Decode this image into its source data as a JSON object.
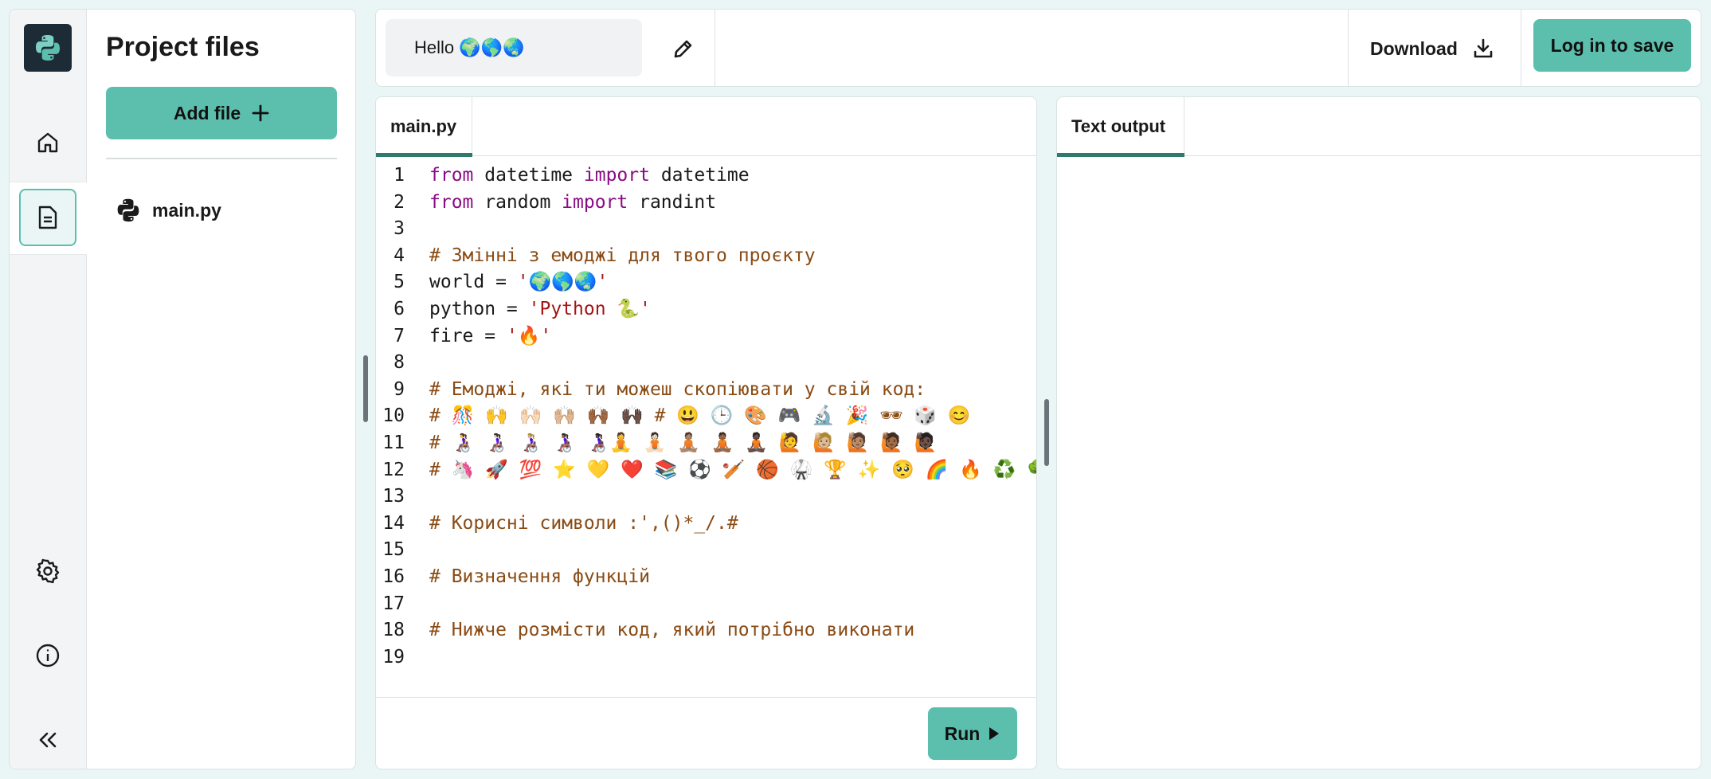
{
  "nav": {
    "logo_icon": "python-logo-icon",
    "items": [
      {
        "icon": "home-icon"
      },
      {
        "icon": "file-icon"
      },
      {
        "icon": "gear-icon"
      },
      {
        "icon": "info-icon"
      },
      {
        "icon": "collapse-chevrons-icon"
      }
    ]
  },
  "files_pane": {
    "title": "Project files",
    "add_file_label": "Add file",
    "files": [
      {
        "name": "main.py"
      }
    ]
  },
  "topbar": {
    "project_name": "Hello 🌍🌎🌏",
    "download_label": "Download",
    "login_label": "Log in to save"
  },
  "editor": {
    "tab_label": "main.py",
    "run_label": "Run",
    "lines": [
      {
        "n": "1",
        "parts": [
          {
            "t": "from",
            "c": "kw"
          },
          {
            "t": " datetime ",
            "c": ""
          },
          {
            "t": "import",
            "c": "kw"
          },
          {
            "t": " datetime",
            "c": ""
          }
        ]
      },
      {
        "n": "2",
        "parts": [
          {
            "t": "from",
            "c": "kw"
          },
          {
            "t": " random ",
            "c": ""
          },
          {
            "t": "import",
            "c": "kw"
          },
          {
            "t": " randint",
            "c": ""
          }
        ]
      },
      {
        "n": "3",
        "parts": []
      },
      {
        "n": "4",
        "parts": [
          {
            "t": "# Змінні з емоджі для твого проєкту",
            "c": "cm"
          }
        ]
      },
      {
        "n": "5",
        "parts": [
          {
            "t": "world = ",
            "c": ""
          },
          {
            "t": "'🌍🌎🌏'",
            "c": "st"
          }
        ]
      },
      {
        "n": "6",
        "parts": [
          {
            "t": "python = ",
            "c": ""
          },
          {
            "t": "'Python 🐍'",
            "c": "st"
          }
        ]
      },
      {
        "n": "7",
        "parts": [
          {
            "t": "fire = ",
            "c": ""
          },
          {
            "t": "'🔥'",
            "c": "st"
          }
        ]
      },
      {
        "n": "8",
        "parts": []
      },
      {
        "n": "9",
        "parts": [
          {
            "t": "# Емоджі, які ти можеш скопіювати у свій код:",
            "c": "cm"
          }
        ]
      },
      {
        "n": "10",
        "parts": [
          {
            "t": "# 🎊 🙌 🙌🏻 🙌🏼 🙌🏾 🙌🏿 # 😃 🕒 🎨 🎮 🔬 🎉 🕶 🎲 😊",
            "c": "cm"
          }
        ]
      },
      {
        "n": "11",
        "parts": [
          {
            "t": "# 👩‍🦽 👩🏻‍🦽 👩🏼‍🦽 👩🏾‍🦽 👩🏿‍🦽🧘 🧘🏻 🧘🏽 🧘🏾 🧘🏿 🙋 🙋🏼 🙋🏽 🙋🏾 🙋🏿",
            "c": "cm"
          }
        ]
      },
      {
        "n": "12",
        "parts": [
          {
            "t": "# 🦄 🚀 💯 ⭐ 💛 ❤️ 📚 ⚽ 🏏 🏀 🥋 🏆 ✨ 🥺 🌈 🔥 ♻️ 🌳",
            "c": "cm"
          }
        ]
      },
      {
        "n": "13",
        "parts": []
      },
      {
        "n": "14",
        "parts": [
          {
            "t": "# Корисні символи :',()*_/.#",
            "c": "cm"
          }
        ]
      },
      {
        "n": "15",
        "parts": []
      },
      {
        "n": "16",
        "parts": [
          {
            "t": "# Визначення функцій",
            "c": "cm"
          }
        ]
      },
      {
        "n": "17",
        "parts": []
      },
      {
        "n": "18",
        "parts": [
          {
            "t": "# Нижче розмісти код, який потрібно виконати",
            "c": "cm"
          }
        ]
      },
      {
        "n": "19",
        "parts": []
      }
    ]
  },
  "output": {
    "tab_label": "Text output"
  },
  "colors": {
    "accent": "#5cbfae",
    "tab_underline": "#2f7a6e",
    "keyword": "#8a0c84",
    "comment": "#8a4b14",
    "string": "#a31515"
  }
}
